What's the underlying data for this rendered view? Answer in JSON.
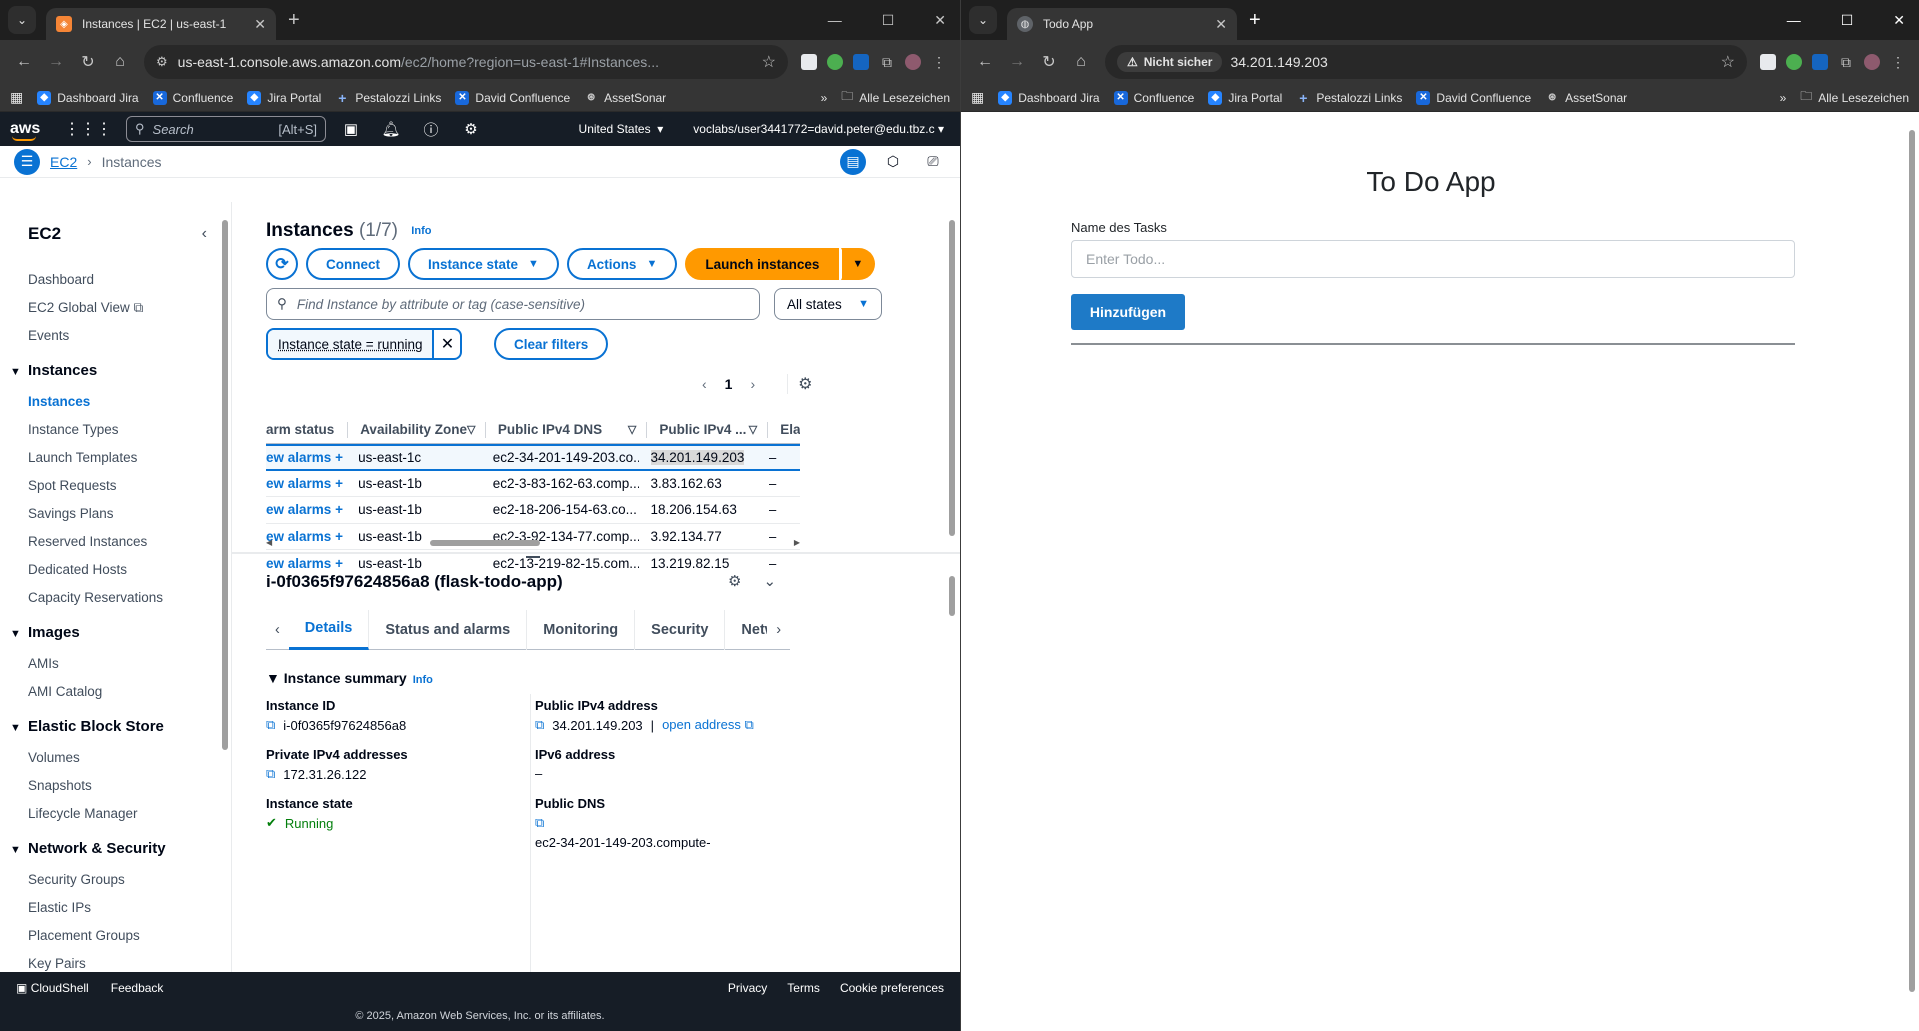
{
  "left_browser": {
    "tab_title": "Instances | EC2 | us-east-1",
    "url_host": "us-east-1.console.aws.amazon.com",
    "url_path": "/ec2/home?region=us-east-1#Instances...",
    "bookmarks": [
      "Dashboard Jira",
      "Confluence",
      "Jira Portal",
      "Pestalozzi Links",
      "David Confluence",
      "AssetSonar"
    ],
    "more_bookmarks": "»",
    "all_bookmarks": "Alle Lesezeichen"
  },
  "right_browser": {
    "tab_title": "Todo App",
    "not_secure": "Nicht sicher",
    "url": "34.201.149.203",
    "bookmarks": [
      "Dashboard Jira",
      "Confluence",
      "Jira Portal",
      "Pestalozzi Links",
      "David Confluence",
      "AssetSonar"
    ],
    "more_bookmarks": "»",
    "all_bookmarks": "Alle Lesezeichen"
  },
  "aws_nav": {
    "logo": "aws",
    "search_placeholder": "Search",
    "search_shortcut": "[Alt+S]",
    "region": "United States",
    "account": "voclabs/user3441772=david.peter@edu.tbz.c"
  },
  "breadcrumb": {
    "service": "EC2",
    "current": "Instances"
  },
  "sidebar": {
    "title": "EC2",
    "top_items": [
      "Dashboard",
      "EC2 Global View",
      "Events"
    ],
    "sections": [
      {
        "title": "Instances",
        "items": [
          "Instances",
          "Instance Types",
          "Launch Templates",
          "Spot Requests",
          "Savings Plans",
          "Reserved Instances",
          "Dedicated Hosts",
          "Capacity Reservations"
        ]
      },
      {
        "title": "Images",
        "items": [
          "AMIs",
          "AMI Catalog"
        ]
      },
      {
        "title": "Elastic Block Store",
        "items": [
          "Volumes",
          "Snapshots",
          "Lifecycle Manager"
        ]
      },
      {
        "title": "Network & Security",
        "items": [
          "Security Groups",
          "Elastic IPs",
          "Placement Groups",
          "Key Pairs"
        ]
      }
    ]
  },
  "instances": {
    "title": "Instances",
    "count": "(1/7)",
    "info": "Info",
    "buttons": {
      "connect": "Connect",
      "instance_state": "Instance state",
      "actions": "Actions",
      "launch": "Launch instances"
    },
    "find_placeholder": "Find Instance by attribute or tag (case-sensitive)",
    "states_filter": "All states",
    "filter_token": "Instance state = running",
    "clear_filters": "Clear filters",
    "page": "1",
    "columns": [
      "arm status",
      "Availability Zone",
      "Public IPv4 DNS",
      "Public IPv4 ...",
      "Ela"
    ],
    "rows": [
      {
        "alarm": "ew alarms",
        "az": "us-east-1c",
        "dns": "ec2-34-201-149-203.co...",
        "ip": "34.201.149.203",
        "ela": "–"
      },
      {
        "alarm": "ew alarms",
        "az": "us-east-1b",
        "dns": "ec2-3-83-162-63.comp...",
        "ip": "3.83.162.63",
        "ela": "–"
      },
      {
        "alarm": "ew alarms",
        "az": "us-east-1b",
        "dns": "ec2-18-206-154-63.co...",
        "ip": "18.206.154.63",
        "ela": "–"
      },
      {
        "alarm": "ew alarms",
        "az": "us-east-1b",
        "dns": "ec2-3-92-134-77.comp...",
        "ip": "3.92.134.77",
        "ela": "–"
      },
      {
        "alarm": "ew alarms",
        "az": "us-east-1b",
        "dns": "ec2-13-219-82-15.com...",
        "ip": "13.219.82.15",
        "ela": "–"
      }
    ]
  },
  "detail": {
    "title": "i-0f0365f97624856a8 (flask-todo-app)",
    "tabs": [
      "Details",
      "Status and alarms",
      "Monitoring",
      "Security",
      "Netwo"
    ],
    "summary_title": "Instance summary",
    "summary_info": "Info",
    "instance_id_label": "Instance ID",
    "instance_id": "i-0f0365f97624856a8",
    "public_ip_label": "Public IPv4 address",
    "public_ip": "34.201.149.203",
    "open_address": "open address",
    "private_ip_label": "Private IPv4 addresses",
    "private_ip": "172.31.26.122",
    "ipv6_label": "IPv6 address",
    "ipv6": "–",
    "state_label": "Instance state",
    "state": "Running",
    "public_dns_label": "Public DNS",
    "public_dns": "ec2-34-201-149-203.compute-"
  },
  "aws_footer": {
    "cloudshell": "CloudShell",
    "feedback": "Feedback",
    "privacy": "Privacy",
    "terms": "Terms",
    "cookies": "Cookie preferences",
    "copyright": "© 2025, Amazon Web Services, Inc. or its affiliates."
  },
  "todo": {
    "title": "To Do App",
    "label": "Name des Tasks",
    "placeholder": "Enter Todo...",
    "add_button": "Hinzufügen"
  },
  "colors": {
    "aws_orange": "#ff9900",
    "aws_blue": "#0972d3",
    "aws_nav": "#161d26",
    "todo_button": "#1e7ac7",
    "running_green": "#037f0c"
  }
}
